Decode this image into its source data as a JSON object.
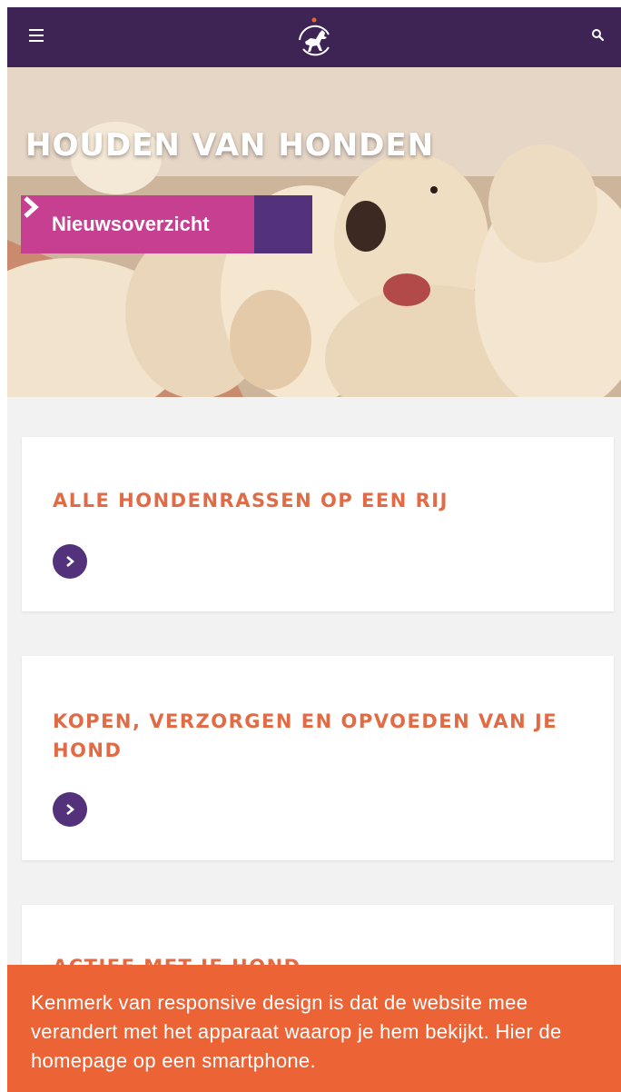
{
  "header": {
    "menu_icon": "hamburger-menu-icon",
    "logo_icon": "dog-logo-icon",
    "search_icon": "search-icon",
    "background_color": "#3e2454"
  },
  "hero": {
    "title": "HOUDEN VAN HONDEN",
    "button_label": "Nieuwsoverzicht",
    "button_color": "#c63f91",
    "arrow_color": "#53327b",
    "image": "golden-retriever-puppies"
  },
  "cards": [
    {
      "title": "ALLE HONDENRASSEN OP EEN RIJ"
    },
    {
      "title": "KOPEN, VERZORGEN EN OPVOEDEN VAN JE HOND"
    },
    {
      "title": "ACTIEF MET JE HOND"
    }
  ],
  "accent_color": "#e06b45",
  "caption": {
    "text": "Kenmerk van responsive design is dat de website mee verandert met het apparaat waarop je hem bekijkt. Hier de homepage op een smartphone.",
    "background_color": "#ec6436"
  }
}
